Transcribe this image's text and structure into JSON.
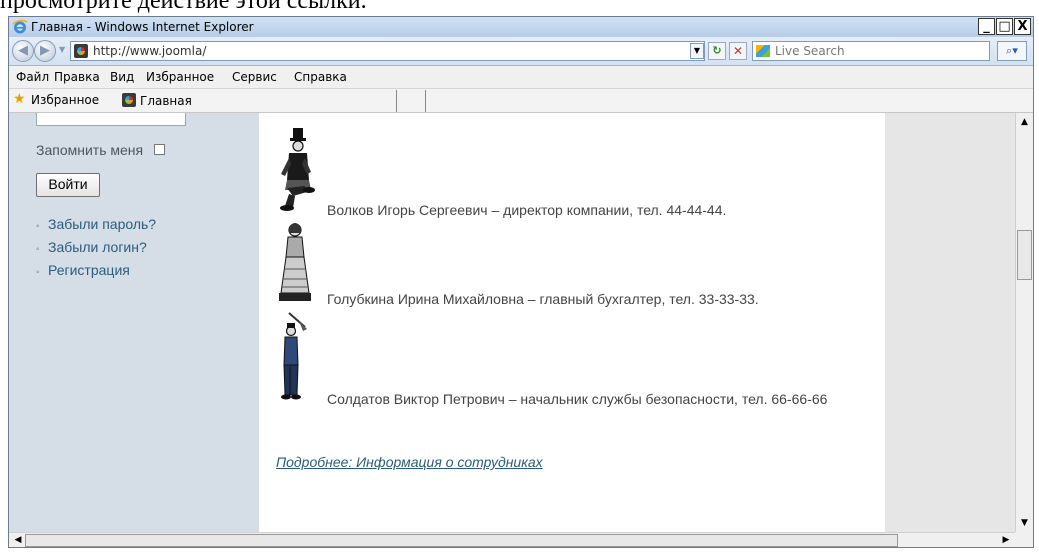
{
  "doc_caption": "просмотрите действие этой ссылки.",
  "window": {
    "title": "Главная - Windows Internet Explorer",
    "minimize": "_",
    "maximize": "□",
    "close": "X"
  },
  "address": {
    "url": "http://www.joomla/",
    "search_placeholder": "Live Search"
  },
  "menu": [
    "Файл",
    "Правка",
    "Вид",
    "Избранное",
    "Сервис",
    "Справка"
  ],
  "favorites": {
    "label": "Избранное",
    "tab_label": "Главная"
  },
  "sidebar": {
    "remember_label": "Запомнить меня",
    "login_button": "Войти",
    "links": [
      "Забыли пароль?",
      "Забыли логин?",
      "Регистрация"
    ]
  },
  "content": {
    "employees": [
      {
        "text": "Волков Игорь Сергеевич – директор компании, тел. 44-44-44."
      },
      {
        "text": "Голубкина Ирина Михайловна – главный бухгалтер, тел. 33-33-33."
      },
      {
        "text": "Солдатов Виктор Петрович – начальник службы безопасности, тел. 66-66-66"
      }
    ],
    "more_link": "Подробнее: Информация о сотрудниках"
  }
}
